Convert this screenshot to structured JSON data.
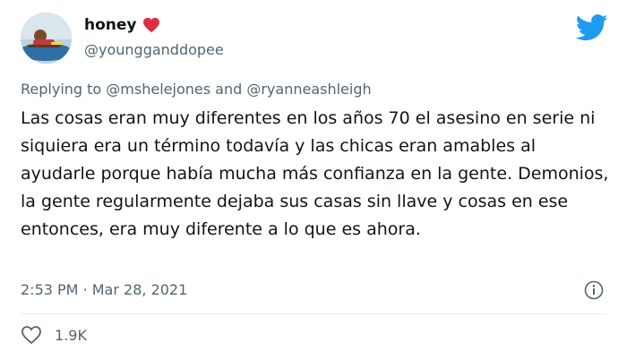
{
  "author": {
    "display_name": "honey",
    "handle": "@youngganddopee",
    "avatar_icon": "profile-photo",
    "badge_icon": "red-heart-emoji",
    "accent": "#e0245e"
  },
  "platform": {
    "logo_icon": "twitter-bird-icon",
    "color": "#1d9bf0"
  },
  "reply": {
    "prefix": "Replying to",
    "mention_1": "@mshelejones",
    "connector": "and",
    "mention_2": "@ryanneashleigh"
  },
  "tweet": {
    "text": "Las cosas eran muy diferentes en los años 70 el asesino en serie ni siquiera era un término todavía y las chicas eran amables al ayudarle porque había mucha más confianza en la gente. Demonios, la gente regularmente dejaba sus casas sin llave y cosas en ese entonces, era muy diferente a lo que es ahora."
  },
  "meta": {
    "time": "2:53 PM",
    "separator": "·",
    "date": "Mar 28, 2021",
    "info_icon": "info-icon"
  },
  "engagement": {
    "like_icon": "heart-outline-icon",
    "like_count": "1.9K"
  }
}
